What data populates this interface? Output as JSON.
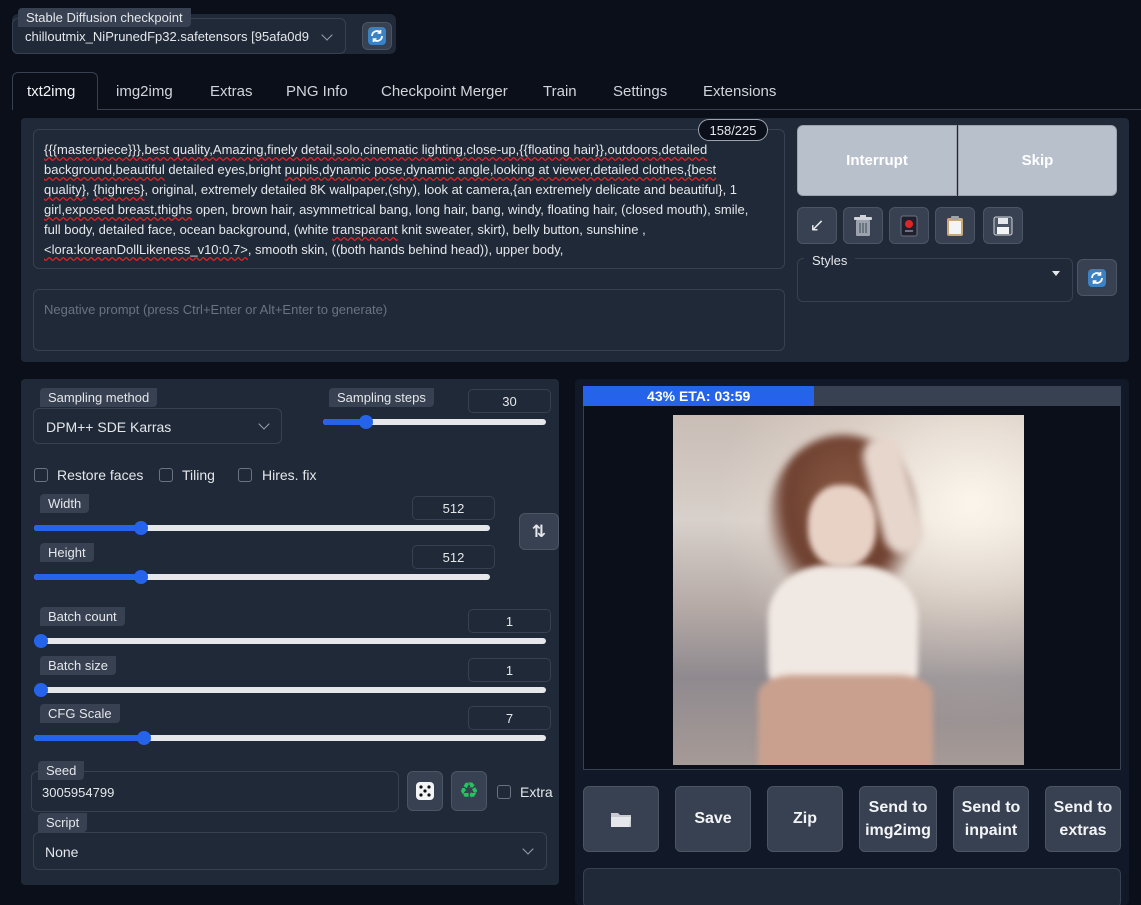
{
  "checkpoint": {
    "label": "Stable Diffusion checkpoint",
    "value": "chilloutmix_NiPrunedFp32.safetensors [95afa0d9"
  },
  "tabs": [
    {
      "label": "txt2img",
      "active": true
    },
    {
      "label": "img2img"
    },
    {
      "label": "Extras"
    },
    {
      "label": "PNG Info"
    },
    {
      "label": "Checkpoint Merger"
    },
    {
      "label": "Train"
    },
    {
      "label": "Settings"
    },
    {
      "label": "Extensions"
    }
  ],
  "prompt": {
    "token_count": "158/225",
    "lines": [
      [
        "{{{masterpiece}}},",
        "best quality,Amazing,finely detail,solo,cinematic lighting,close-up,{{floating hair}},outdoors,detailed"
      ],
      [
        "background,beautiful",
        " detailed eyes,bright ",
        "pupils,dynamic pose,dynamic angle,looking at viewer,detailed clothes,{best"
      ],
      [
        "quality}",
        ", ",
        "{highres}",
        ", original, extremely detailed 8K wallpaper,(shy), look at camera,{an extremely delicate and beautiful}, 1"
      ],
      [
        "girl,exposed breast,thighs",
        " open, brown hair, asymmetrical bang, long hair, bang, windy, floating hair, (closed mouth), smile,"
      ],
      [
        "full body, detailed face, ocean background, (white ",
        "transparant",
        " knit sweater, skirt), belly button, sunshine ,"
      ],
      [
        "<lora:koreanDollLikeness_v10:0.7>",
        ", smooth skin, ((both hands behind head)), upper body,"
      ]
    ]
  },
  "negative_prompt": {
    "placeholder": "Negative prompt (press Ctrl+Enter or Alt+Enter to generate)"
  },
  "actions": {
    "interrupt": "Interrupt",
    "skip": "Skip"
  },
  "styles": {
    "label": "Styles",
    "value": ""
  },
  "sampling": {
    "method_label": "Sampling method",
    "method_value": "DPM++ SDE Karras",
    "steps_label": "Sampling steps",
    "steps_value": "30",
    "steps_num": 30,
    "steps_min": 1,
    "steps_max": 150
  },
  "checkboxes": {
    "restore_faces": "Restore faces",
    "tiling": "Tiling",
    "hires_fix": "Hires. fix"
  },
  "size": {
    "width_label": "Width",
    "width_value": "512",
    "height_label": "Height",
    "height_value": "512"
  },
  "batch": {
    "count_label": "Batch count",
    "count_value": "1",
    "size_label": "Batch size",
    "size_value": "1"
  },
  "cfg": {
    "label": "CFG Scale",
    "value": "7"
  },
  "seed": {
    "label": "Seed",
    "value": "3005954799",
    "extra_label": "Extra"
  },
  "script": {
    "label": "Script",
    "value": "None"
  },
  "progress": {
    "text": "43% ETA: 03:59",
    "percent": 43
  },
  "output_buttons": {
    "save": "Save",
    "zip": "Zip",
    "send_img2img": "Send to img2img",
    "send_inpaint": "Send to inpaint",
    "send_extras": "Send to extras"
  },
  "colors": {
    "accent": "#2563eb",
    "background": "#0b0f19",
    "panel": "#1f2937"
  }
}
